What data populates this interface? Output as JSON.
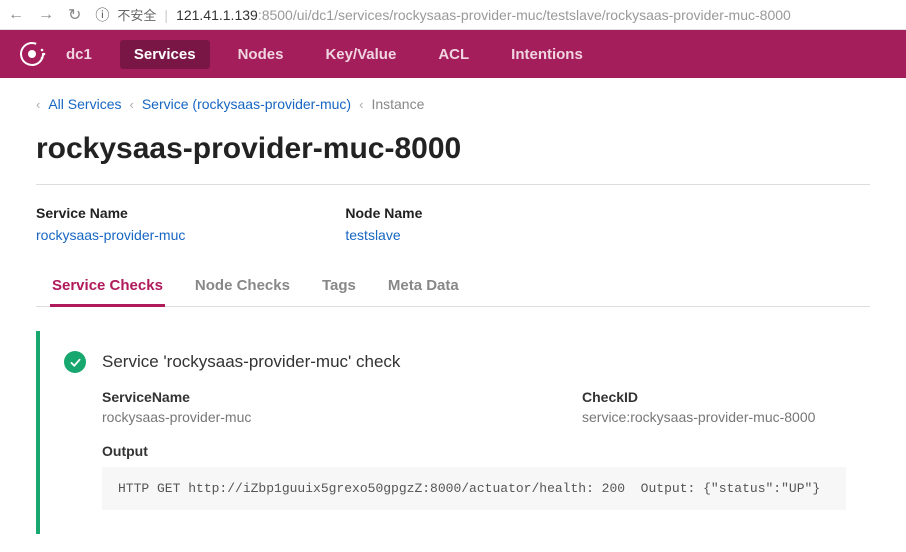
{
  "browser": {
    "insecure_label": "不安全",
    "url_host": "121.41.1.139",
    "url_port_path": ":8500/ui/dc1/services/rockysaas-provider-muc/testslave/rockysaas-provider-muc-8000"
  },
  "nav": {
    "datacenter": "dc1",
    "items": [
      "Services",
      "Nodes",
      "Key/Value",
      "ACL",
      "Intentions"
    ]
  },
  "breadcrumb": {
    "all_services": "All Services",
    "service": "Service (rockysaas-provider-muc)",
    "current": "Instance"
  },
  "page_title": "rockysaas-provider-muc-8000",
  "meta": {
    "service_name_label": "Service Name",
    "service_name_value": "rockysaas-provider-muc",
    "node_name_label": "Node Name",
    "node_name_value": "testslave"
  },
  "tabs": [
    "Service Checks",
    "Node Checks",
    "Tags",
    "Meta Data"
  ],
  "check": {
    "title": "Service 'rockysaas-provider-muc' check",
    "service_name_label": "ServiceName",
    "service_name_value": "rockysaas-provider-muc",
    "check_id_label": "CheckID",
    "check_id_value": "service:rockysaas-provider-muc-8000",
    "output_label": "Output",
    "output_value": "HTTP GET http://iZbp1guuix5grexo50gpgzZ:8000/actuator/health: 200  Output: {\"status\":\"UP\"}"
  }
}
